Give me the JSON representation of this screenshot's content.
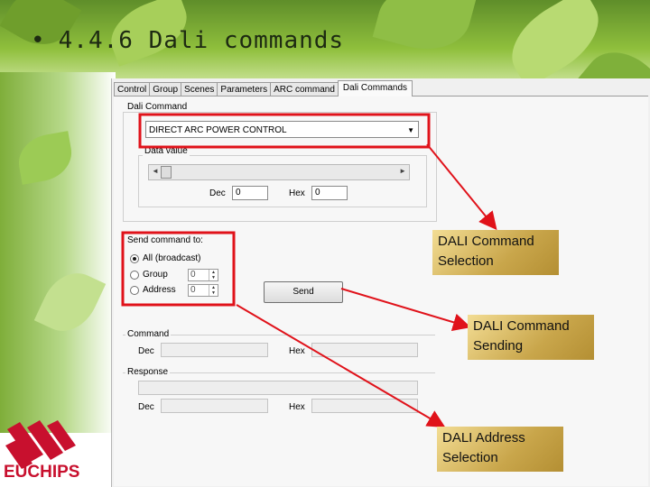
{
  "slide": {
    "bullet": "•",
    "title": "4.4.6 Dali commands"
  },
  "logo": {
    "text": "EUCHIPS"
  },
  "tabs": [
    "Control",
    "Group",
    "Scenes",
    "Parameters",
    "ARC command",
    "Dali Commands"
  ],
  "dali_command": {
    "group_label": "Dali Command",
    "selected": "DIRECT ARC POWER CONTROL",
    "data_value_label": "Data value",
    "dec_label": "Dec",
    "dec_value": "0",
    "hex_label": "Hex",
    "hex_value": "0"
  },
  "send_to": {
    "label": "Send command to:",
    "options": [
      {
        "label": "All (broadcast)",
        "selected": true
      },
      {
        "label": "Group",
        "value": "0"
      },
      {
        "label": "Address",
        "value": "0"
      }
    ]
  },
  "send_button": "Send",
  "command": {
    "label": "Command",
    "dec_label": "Dec",
    "hex_label": "Hex"
  },
  "response": {
    "label": "Response",
    "dec_label": "Dec",
    "hex_label": "Hex"
  },
  "callouts": {
    "selection": "DALI Command Selection",
    "sending": "DALI Command Sending",
    "address": "DALI  Address Selection"
  },
  "colors": {
    "highlight": "#e0121a",
    "callout_gold": "#d4b45c"
  }
}
